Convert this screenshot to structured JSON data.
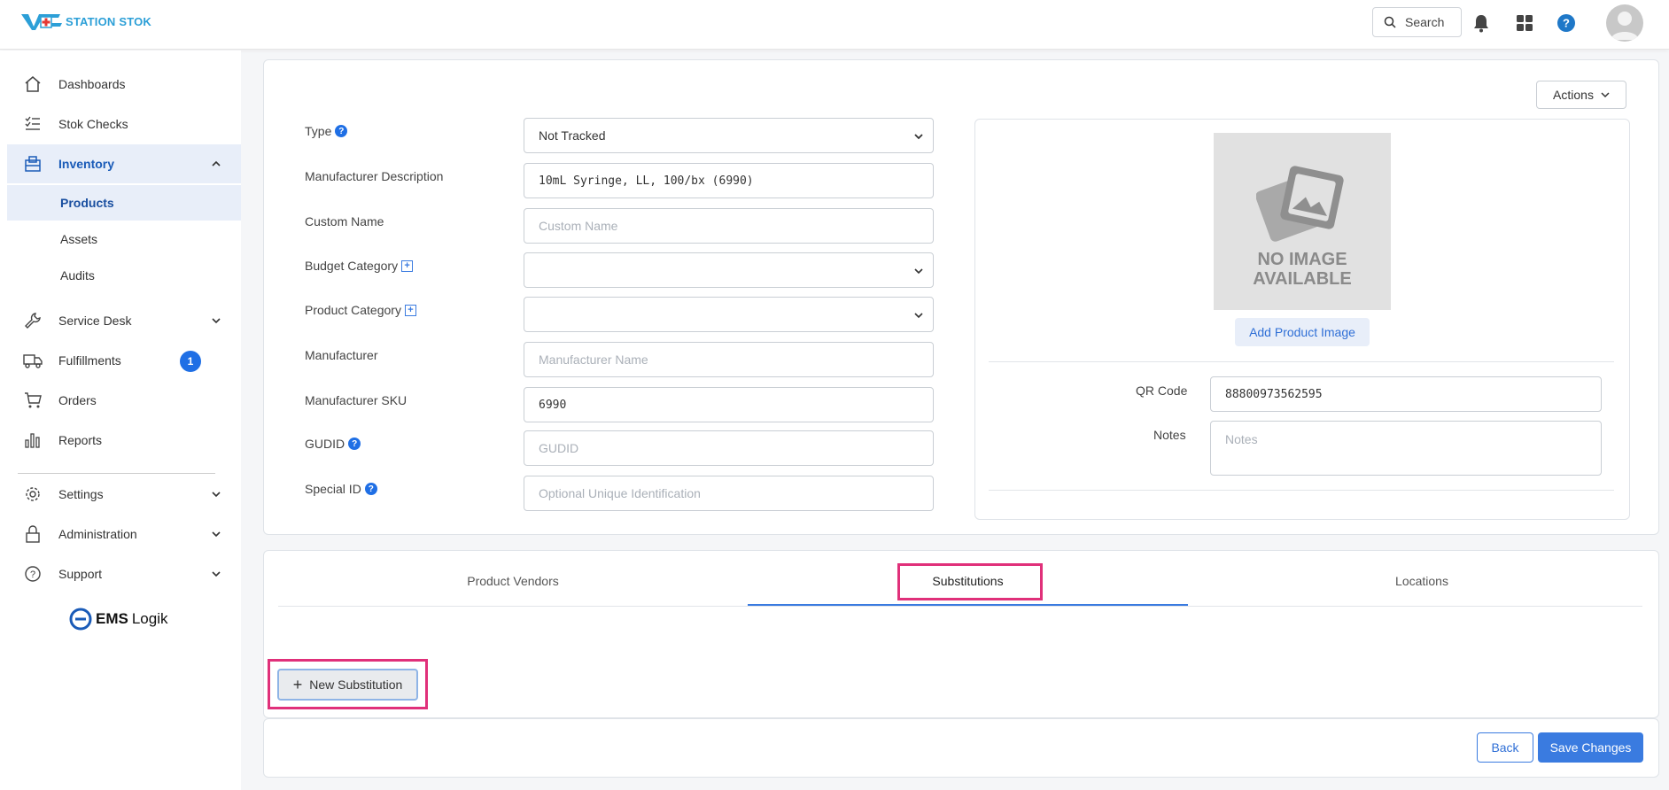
{
  "header": {
    "brand": "STATION STOK",
    "search_label": "Search"
  },
  "sidebar": {
    "items": [
      {
        "label": "Dashboards"
      },
      {
        "label": "Stok Checks"
      },
      {
        "label": "Inventory"
      },
      {
        "label": "Service Desk"
      },
      {
        "label": "Fulfillments",
        "badge": "1"
      },
      {
        "label": "Orders"
      },
      {
        "label": "Reports"
      },
      {
        "label": "Settings"
      },
      {
        "label": "Administration"
      },
      {
        "label": "Support"
      }
    ],
    "inventory_sub": [
      {
        "label": "Products"
      },
      {
        "label": "Assets"
      },
      {
        "label": "Audits"
      }
    ],
    "footer_logo_bold": "EMS",
    "footer_logo_rest": "Logik"
  },
  "form": {
    "actions_label": "Actions",
    "type_label": "Type",
    "type_value": "Not Tracked",
    "mfr_desc_label": "Manufacturer Description",
    "mfr_desc_value": "10mL Syringe, LL, 100/bx (6990)",
    "custom_name_label": "Custom Name",
    "custom_name_placeholder": "Custom Name",
    "budget_category_label": "Budget Category",
    "budget_category_value": "",
    "product_category_label": "Product Category",
    "product_category_value": "",
    "manufacturer_label": "Manufacturer",
    "manufacturer_placeholder": "Manufacturer Name",
    "mfr_sku_label": "Manufacturer SKU",
    "mfr_sku_value": "6990",
    "gudid_label": "GUDID",
    "gudid_placeholder": "GUDID",
    "special_id_label": "Special ID",
    "special_id_placeholder": "Optional Unique Identification"
  },
  "image_panel": {
    "no_image_line1": "NO IMAGE",
    "no_image_line2": "AVAILABLE",
    "add_image_label": "Add Product Image",
    "qr_label": "QR Code",
    "qr_value": "88800973562595",
    "notes_label": "Notes",
    "notes_placeholder": "Notes"
  },
  "tabs": [
    {
      "label": "Product Vendors"
    },
    {
      "label": "Substitutions",
      "active": true
    },
    {
      "label": "Locations"
    }
  ],
  "substitutions": {
    "new_label": "New Substitution"
  },
  "footer": {
    "back_label": "Back",
    "save_label": "Save Changes"
  },
  "colors": {
    "accent": "#3a7be0",
    "highlight": "#e0307a",
    "active_bg": "#e8eef9"
  }
}
